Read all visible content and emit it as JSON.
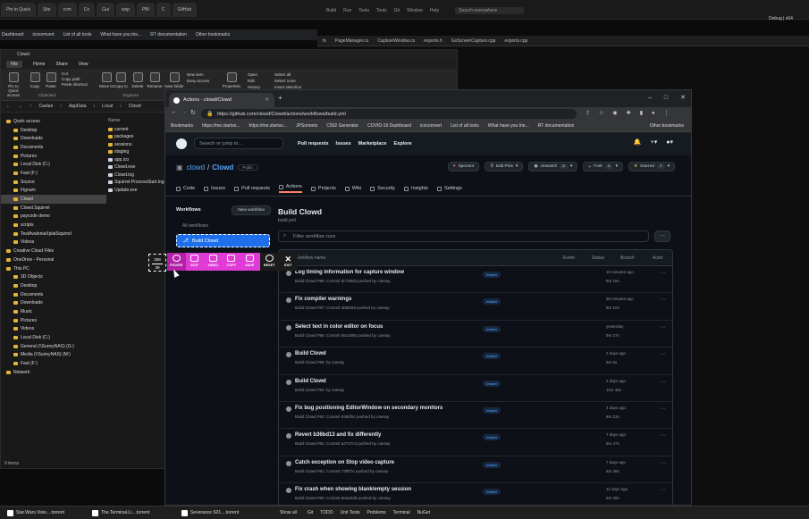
{
  "bg_tabs": [
    "Pin to Quick",
    "Site",
    "cvm",
    "Co",
    "Gui",
    "wsp",
    "PBI",
    "C",
    "GitHub"
  ],
  "bg_bookmarks": [
    "Dashboard",
    "icocomvert",
    "List of all tools",
    "What have you trie...",
    "RT documentation",
    "Other bookmarks"
  ],
  "ide_menu": [
    "Build",
    "Run",
    "Tests",
    "Tools",
    "Git",
    "Window",
    "Help"
  ],
  "ide_search": "Search everywhere",
  "ide_tabs": [
    "fs",
    "PageManager.cs",
    "CaptureWindow.cs",
    "exports.h",
    "GoScreenCapture.cpp",
    "exports.cpp"
  ],
  "ide_debug": "Debug | x64",
  "explorer": {
    "title": "Clowd",
    "menu": [
      "File",
      "Home",
      "Share",
      "View"
    ],
    "ribbon": [
      "Pin to Quick access",
      "Copy",
      "Paste",
      "Cut",
      "Copy path",
      "Paste shortcut",
      "Move to",
      "Copy to",
      "Delete",
      "Rename",
      "New folder",
      "New item",
      "Easy access",
      "Properties",
      "Open",
      "Edit",
      "History",
      "Select all",
      "Select none",
      "Invert selection"
    ],
    "ribbon_groups": [
      "Clipboard",
      "Organize",
      "New",
      "Open",
      "Select"
    ],
    "path": [
      "Caelan",
      "AppData",
      "Local",
      "Clowd"
    ],
    "nav": [
      "Quick access",
      "Desktop",
      "Downloads",
      "Documents",
      "Pictures",
      "Local Disk (C:)",
      "Fast (F:)",
      "Source",
      "Fignum",
      "Clowd",
      "Clowd.Squirrel",
      "paycode demo",
      "scripts",
      "TestAvaloniaXplatSquirrel",
      "Videos",
      "Creative Cloud Files",
      "OneDrive - Personal",
      "This PC",
      "3D Objects",
      "Desktop",
      "Documents",
      "Downloads",
      "Music",
      "Pictures",
      "Videos",
      "Local Disk (C:)",
      "General (\\\\SunnyNAS) (G:)",
      "Media (\\\\SunnyNAS) (M:)",
      "Fast (F:)",
      "Network"
    ],
    "nav_selected": 9,
    "files_header": "Name",
    "files": [
      "current",
      "packages",
      "sessions",
      "staging",
      "app.ico",
      "Clowd.exe",
      "Clowd.log",
      "Squirrel-ProcessStart.log",
      "Update.exe"
    ],
    "status": "9 items"
  },
  "taskbar": [
    "Star.Wars.Visio....torrent",
    "The.Terminal.Li....torrent",
    "Severance S01....torrent",
    "Show all",
    "Git",
    "TODO",
    "Unit Tests",
    "Problems",
    "Terminal",
    "NuGet"
  ],
  "browser": {
    "tab_title": "Actions · clowd/Clowd",
    "url": "https://github.com/clowd/Clowd/actions/workflows/build.yml",
    "bookmarks": [
      "Bookmarks",
      "https://me.startso...",
      "https://me.startso...",
      "JPSonnets",
      "C502 Generator",
      "COVID-19 Dashboard",
      "icocomvert",
      "List of all tools",
      "What have you trie...",
      "RT documentation",
      "Other bookmarks"
    ]
  },
  "github": {
    "search": "Search or jump to...",
    "nav": [
      "Pull requests",
      "Issues",
      "Marketplace",
      "Explore"
    ],
    "owner": "clowd",
    "repo": "Clowd",
    "visibility": "Public",
    "buttons": [
      {
        "label": "Sponsor",
        "count": ""
      },
      {
        "label": "Edit Pins",
        "count": ""
      },
      {
        "label": "Unwatch",
        "count": "2"
      },
      {
        "label": "Fork",
        "count": "1"
      },
      {
        "label": "Starred",
        "count": "7"
      }
    ],
    "tabs": [
      "Code",
      "Issues",
      "Pull requests",
      "Actions",
      "Projects",
      "Wiki",
      "Security",
      "Insights",
      "Settings"
    ],
    "active_tab": "Actions",
    "workflows_label": "Workflows",
    "new_workflow": "New workflow",
    "all_workflows": "All workflows",
    "selected_workflow": "Build Clowd",
    "wf_title": "Build Clowd",
    "wf_file": "build.yml",
    "filter_placeholder": "Filter workflow runs",
    "runs_header": {
      "name": "Workflow name",
      "event": "Event",
      "status": "Status",
      "branch": "Branch",
      "actor": "Actor"
    },
    "runs": [
      {
        "title": "Log timing information for capture window",
        "sub": "Build Clowd #98: Commit dc7a8d3 pushed by caesay",
        "branch": "master",
        "when": "19 minutes ago",
        "dur": "5m 16s"
      },
      {
        "title": "Fix compiler warnings",
        "sub": "Build Clowd #97: Commit afd8d48 pushed by caesay",
        "branch": "master",
        "when": "58 minutes ago",
        "dur": "8m 10s"
      },
      {
        "title": "Select text in color editor on focus",
        "sub": "Build Clowd #96: Commit 56c2085 pushed by caesay",
        "branch": "master",
        "when": "yesterday",
        "dur": "9m 27s"
      },
      {
        "title": "Build Clowd",
        "sub": "Build Clowd #95: by caesay",
        "branch": "master",
        "when": "2 days ago",
        "dur": "8m 5s"
      },
      {
        "title": "Build Clowd",
        "sub": "Build Clowd #94: by caesay",
        "branch": "master",
        "when": "2 days ago",
        "dur": "11m 48s"
      },
      {
        "title": "Fix bug positioning EditorWindow on secondary monitors",
        "sub": "Build Clowd #93: Commit 6360f2c pushed by caesay",
        "branch": "master",
        "when": "4 days ago",
        "dur": "8m 23s"
      },
      {
        "title": "Revert b36bd13 and fix differently",
        "sub": "Build Clowd #92: Commit a2727c3 pushed by caesay",
        "branch": "master",
        "when": "7 days ago",
        "dur": "5m 47s"
      },
      {
        "title": "Catch exception on Stop video capture",
        "sub": "Build Clowd #91: Commit 73f6f7e pushed by caesay",
        "branch": "master",
        "when": "7 days ago",
        "dur": "5m 38s"
      },
      {
        "title": "Fix crash when showing blank/empty session",
        "sub": "Build Clowd #90: Commit 5eaa3d0 pushed by caesay",
        "branch": "master",
        "when": "11 days ago",
        "dur": "5m 28s"
      }
    ]
  },
  "capture": {
    "size_w": "258",
    "size_h": "39",
    "buttons": [
      "PICKER",
      "EDIT",
      "VIDEO",
      "COPY",
      "SAVE",
      "RESET",
      "EXIT"
    ]
  }
}
